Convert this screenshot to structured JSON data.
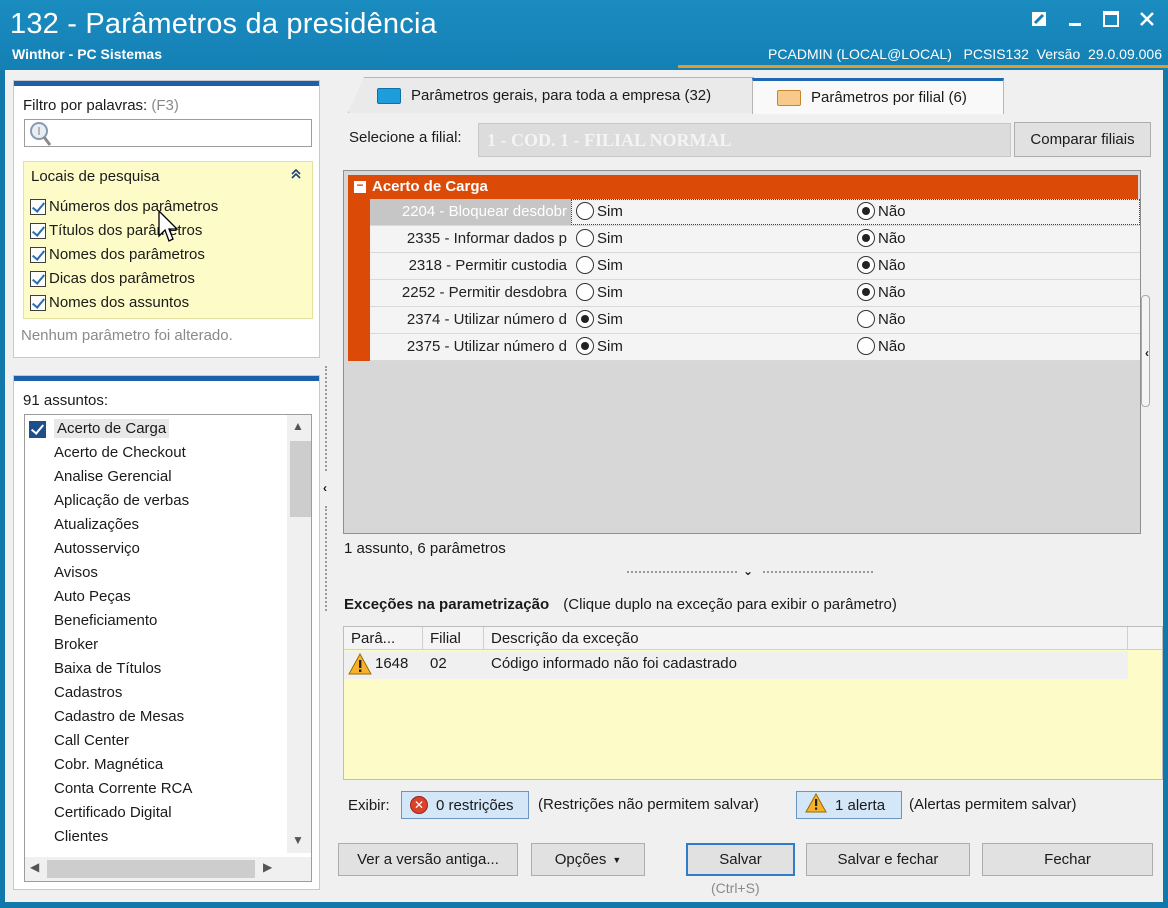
{
  "window": {
    "title": "132 - Parâmetros da presidência",
    "subtitle": "Winthor - PC Sistemas",
    "user_info": "PCADMIN (LOCAL@LOCAL)   PCSIS132  Versão  29.0.09.006"
  },
  "filter": {
    "label": "Filtro por palavras:",
    "shortcut": "(F3)",
    "search_value": "",
    "locais_title": "Locais de pesquisa",
    "options": [
      {
        "label": "Números dos parâmetros",
        "checked": true
      },
      {
        "label": "Títulos dos parâmetros",
        "checked": true
      },
      {
        "label": "Nomes dos parâmetros",
        "checked": true
      },
      {
        "label": "Dicas dos parâmetros",
        "checked": true
      },
      {
        "label": "Nomes dos assuntos",
        "checked": true
      }
    ],
    "status": "Nenhum parâmetro foi alterado."
  },
  "subjects": {
    "count_label": "91 assuntos:",
    "items": [
      {
        "label": "Acerto de Carga",
        "checked": true
      },
      {
        "label": "Acerto de Checkout"
      },
      {
        "label": "Analise Gerencial"
      },
      {
        "label": "Aplicação de verbas"
      },
      {
        "label": "Atualizações"
      },
      {
        "label": "Autosserviço"
      },
      {
        "label": "Avisos"
      },
      {
        "label": "Auto Peças"
      },
      {
        "label": "Beneficiamento"
      },
      {
        "label": "Broker"
      },
      {
        "label": "Baixa de Títulos"
      },
      {
        "label": "Cadastros"
      },
      {
        "label": "Cadastro de Mesas"
      },
      {
        "label": "Call Center"
      },
      {
        "label": "Cobr. Magnética"
      },
      {
        "label": "Conta Corrente RCA"
      },
      {
        "label": "Certificado Digital"
      },
      {
        "label": "Clientes"
      }
    ]
  },
  "tabs": [
    {
      "label": "Parâmetros gerais, para toda a empresa  (32)",
      "active": false
    },
    {
      "label": "Parâmetros por filial  (6)",
      "active": true
    }
  ],
  "filial": {
    "label": "Selecione a filial:",
    "value": "1 - COD. 1 - FILIAL NORMAL",
    "compare_button": "Comparar filiais"
  },
  "param_group": {
    "title": "Acerto de Carga",
    "yes_label": "Sim",
    "no_label": "Não",
    "rows": [
      {
        "name": "2204 - Bloquear desdobr",
        "value": "Não"
      },
      {
        "name": "2335 - Informar dados p",
        "value": "Não"
      },
      {
        "name": "2318 - Permitir custodia",
        "value": "Não"
      },
      {
        "name": "2252 - Permitir desdobra",
        "value": "Não"
      },
      {
        "name": "2374 - Utilizar número d",
        "value": "Sim"
      },
      {
        "name": "2375 - Utilizar número d",
        "value": "Sim"
      }
    ]
  },
  "grid_status": "1 assunto, 6 parâmetros",
  "exceptions": {
    "title": "Exceções na parametrização",
    "hint": "(Clique duplo na exceção para exibir o parâmetro)",
    "columns": [
      "Parâ...",
      "Filial",
      "Descrição da exceção"
    ],
    "rows": [
      {
        "param": "1648",
        "filial": "02",
        "description": "Código informado não foi cadastrado"
      }
    ]
  },
  "footer": {
    "exibir_label": "Exibir:",
    "restrictions_button": "0 restrições",
    "restrictions_note": "(Restrições não permitem salvar)",
    "alerts_button": "1 alerta",
    "alerts_note": "(Alertas permitem salvar)"
  },
  "actions": {
    "old_version": "Ver a versão antiga...",
    "options": "Opções",
    "save": "Salvar",
    "save_shortcut": "(Ctrl+S)",
    "save_close": "Salvar e fechar",
    "close": "Fechar"
  }
}
